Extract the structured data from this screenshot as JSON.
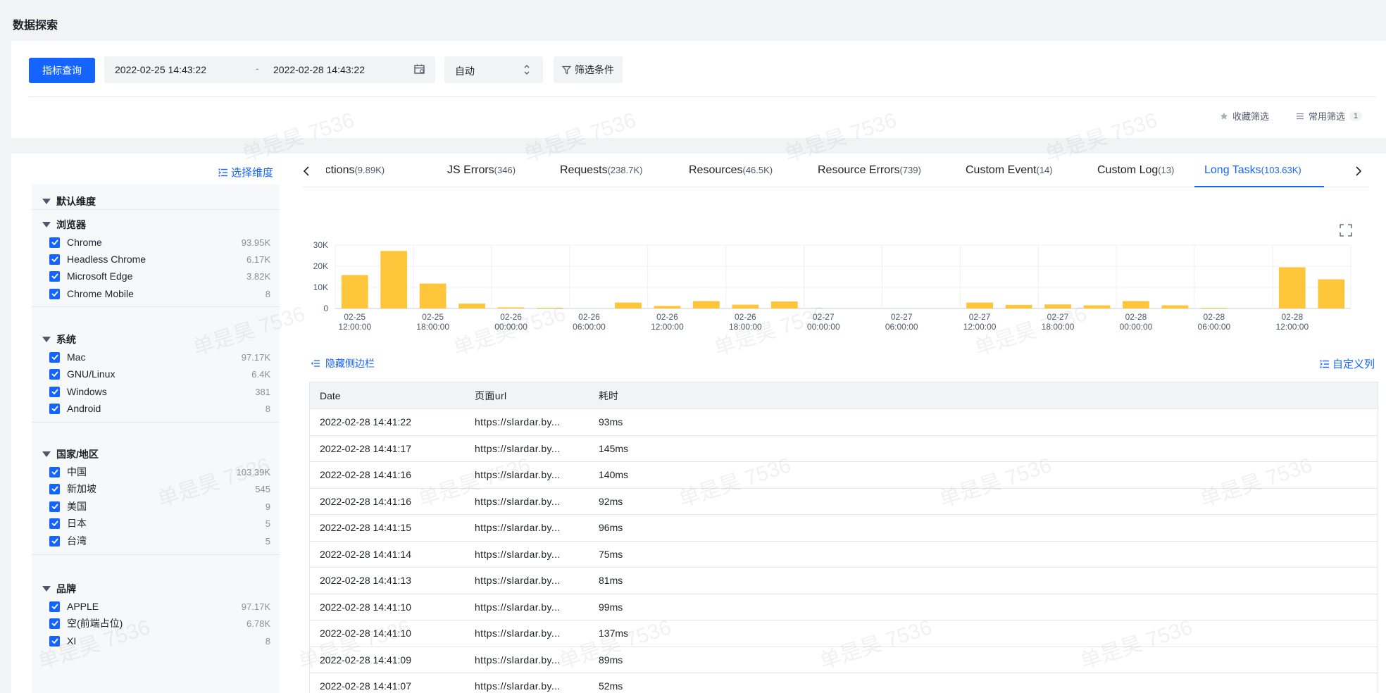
{
  "page": {
    "title": "数据探索"
  },
  "query": {
    "submit_label": "指标查询",
    "start_date": "2022-02-25 14:43:22",
    "date_separator": "-",
    "end_date": "2022-02-28 14:43:22",
    "granularity": "自动",
    "filter_label": "筛选条件",
    "favorite_filter_label": "收藏筛选",
    "common_filter_label": "常用筛选",
    "common_filter_count": "1"
  },
  "sidebar": {
    "select_dimension_label": "选择维度",
    "default_dimension_label": "默认维度",
    "groups": [
      {
        "title": "浏览器",
        "items": [
          {
            "label": "Chrome",
            "count": "93.95K",
            "checked": true
          },
          {
            "label": "Headless Chrome",
            "count": "6.17K",
            "checked": true
          },
          {
            "label": "Microsoft Edge",
            "count": "3.82K",
            "checked": true
          },
          {
            "label": "Chrome Mobile",
            "count": "8",
            "checked": true
          }
        ]
      },
      {
        "title": "系统",
        "items": [
          {
            "label": "Mac",
            "count": "97.17K",
            "checked": true
          },
          {
            "label": "GNU/Linux",
            "count": "6.4K",
            "checked": true
          },
          {
            "label": "Windows",
            "count": "381",
            "checked": true
          },
          {
            "label": "Android",
            "count": "8",
            "checked": true
          }
        ]
      },
      {
        "title": "国家/地区",
        "items": [
          {
            "label": "中国",
            "count": "103.39K",
            "checked": true
          },
          {
            "label": "新加坡",
            "count": "545",
            "checked": true
          },
          {
            "label": "美国",
            "count": "9",
            "checked": true
          },
          {
            "label": "日本",
            "count": "5",
            "checked": true
          },
          {
            "label": "台湾",
            "count": "5",
            "checked": true
          }
        ]
      },
      {
        "title": "品牌",
        "items": [
          {
            "label": "APPLE",
            "count": "97.17K",
            "checked": true
          },
          {
            "label": "空(前端占位)",
            "count": "6.78K",
            "checked": true
          },
          {
            "label": "XI",
            "count": "8",
            "checked": true
          }
        ]
      }
    ]
  },
  "tabs": [
    {
      "label": "Actions",
      "count": "(9.89K)",
      "active": false
    },
    {
      "label": "JS Errors",
      "count": "(346)",
      "active": false
    },
    {
      "label": "Requests",
      "count": "(238.7K)",
      "active": false
    },
    {
      "label": "Resources",
      "count": "(46.5K)",
      "active": false
    },
    {
      "label": "Resource Errors",
      "count": "(739)",
      "active": false
    },
    {
      "label": "Custom Event",
      "count": "(14)",
      "active": false
    },
    {
      "label": "Custom Log",
      "count": "(13)",
      "active": false
    },
    {
      "label": "Long Tasks",
      "count": "(103.63K)",
      "active": true
    }
  ],
  "chart_data": {
    "type": "bar",
    "color": "#fcc53a",
    "ylim": [
      0,
      30000
    ],
    "y_ticks": [
      "0",
      "10K",
      "20K",
      "30K"
    ],
    "x_tick_labels": [
      [
        "02-25",
        "12:00:00"
      ],
      [
        "02-25",
        "18:00:00"
      ],
      [
        "02-26",
        "00:00:00"
      ],
      [
        "02-26",
        "06:00:00"
      ],
      [
        "02-26",
        "12:00:00"
      ],
      [
        "02-26",
        "18:00:00"
      ],
      [
        "02-27",
        "00:00:00"
      ],
      [
        "02-27",
        "06:00:00"
      ],
      [
        "02-27",
        "12:00:00"
      ],
      [
        "02-27",
        "18:00:00"
      ],
      [
        "02-28",
        "00:00:00"
      ],
      [
        "02-28",
        "06:00:00"
      ],
      [
        "02-28",
        "12:00:00"
      ]
    ],
    "values": [
      15800,
      27200,
      11800,
      2300,
      500,
      200,
      0,
      2800,
      1200,
      3500,
      1800,
      3300,
      0,
      0,
      0,
      0,
      2800,
      1700,
      1900,
      1500,
      3500,
      1500,
      300,
      0,
      19500,
      13800
    ]
  },
  "actions": {
    "hide_sidebar_label": "隐藏侧边栏",
    "custom_columns_label": "自定义列"
  },
  "table": {
    "columns": [
      "Date",
      "页面url",
      "耗时"
    ],
    "rows": [
      [
        "2022-02-28 14:41:22",
        "https://slardar.by...",
        "93ms"
      ],
      [
        "2022-02-28 14:41:17",
        "https://slardar.by...",
        "145ms"
      ],
      [
        "2022-02-28 14:41:16",
        "https://slardar.by...",
        "140ms"
      ],
      [
        "2022-02-28 14:41:16",
        "https://slardar.by...",
        "92ms"
      ],
      [
        "2022-02-28 14:41:15",
        "https://slardar.by...",
        "96ms"
      ],
      [
        "2022-02-28 14:41:14",
        "https://slardar.by...",
        "75ms"
      ],
      [
        "2022-02-28 14:41:13",
        "https://slardar.by...",
        "81ms"
      ],
      [
        "2022-02-28 14:41:10",
        "https://slardar.by...",
        "99ms"
      ],
      [
        "2022-02-28 14:41:10",
        "https://slardar.by...",
        "137ms"
      ],
      [
        "2022-02-28 14:41:09",
        "https://slardar.by...",
        "89ms"
      ],
      [
        "2022-02-28 14:41:07",
        "https://slardar.by...",
        "52ms"
      ]
    ]
  },
  "watermark": "单是昊 7536"
}
